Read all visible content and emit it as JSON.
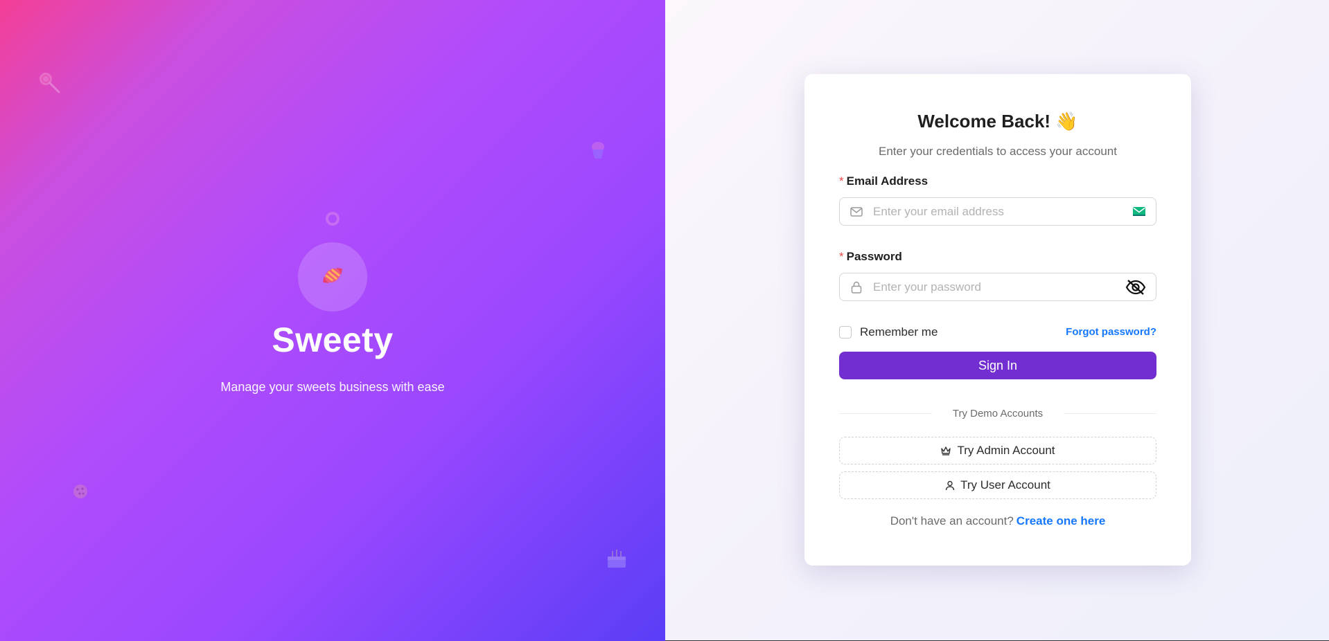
{
  "brand": {
    "name": "Sweety",
    "tagline": "Manage your sweets business with ease",
    "logo_icon": "candy-icon"
  },
  "decorations": [
    "lollipop-icon",
    "cupcake-icon",
    "donut-icon",
    "cookie-icon",
    "cake-icon"
  ],
  "card": {
    "title": "Welcome Back! 👋",
    "subtitle": "Enter your credentials to access your account"
  },
  "email": {
    "label": "Email Address",
    "required_mark": "*",
    "placeholder": "Enter your email address",
    "value": "",
    "icon": "mail-icon",
    "suffix_icon": "mail-check-icon"
  },
  "password": {
    "label": "Password",
    "required_mark": "*",
    "placeholder": "Enter your password",
    "value": "",
    "icon": "lock-icon",
    "toggle_icon": "eye-off-icon"
  },
  "remember": {
    "label": "Remember me",
    "checked": false
  },
  "forgot_link": "Forgot password?",
  "signin_label": "Sign In",
  "demo": {
    "divider_label": "Try Demo Accounts",
    "admin_label": "Try Admin Account",
    "user_label": "Try User Account"
  },
  "footer": {
    "prompt": "Don't have an account?",
    "link": "Create one here"
  },
  "colors": {
    "primary": "#722ed1",
    "link": "#1677ff",
    "required": "#ef4444",
    "gradient_start": "#f43f96",
    "gradient_mid": "#b14cfb",
    "gradient_end": "#5a3ef6"
  }
}
